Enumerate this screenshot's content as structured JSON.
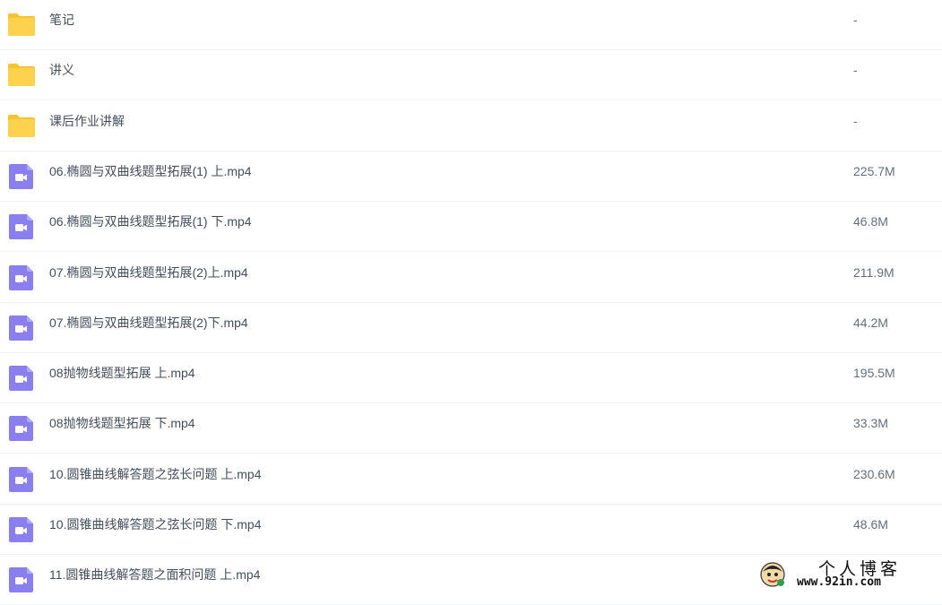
{
  "colors": {
    "folder": "#ffd24d",
    "folder_tab": "#f7c431",
    "video": "#8b7ff0",
    "row_divider": "#f1f2f4",
    "name_text": "#454d5a",
    "size_text": "#666e7a"
  },
  "files": [
    {
      "type": "folder",
      "icon": "folder-icon",
      "name": "笔记",
      "size": "-"
    },
    {
      "type": "folder",
      "icon": "folder-icon",
      "name": "讲义",
      "size": "-"
    },
    {
      "type": "folder",
      "icon": "folder-icon",
      "name": "课后作业讲解",
      "size": "-"
    },
    {
      "type": "video",
      "icon": "video-file-icon",
      "name": "06.椭圆与双曲线题型拓展(1) 上.mp4",
      "size": "225.7M"
    },
    {
      "type": "video",
      "icon": "video-file-icon",
      "name": "06.椭圆与双曲线题型拓展(1) 下.mp4",
      "size": "46.8M"
    },
    {
      "type": "video",
      "icon": "video-file-icon",
      "name": "07.椭圆与双曲线题型拓展(2)上.mp4",
      "size": "211.9M"
    },
    {
      "type": "video",
      "icon": "video-file-icon",
      "name": "07.椭圆与双曲线题型拓展(2)下.mp4",
      "size": "44.2M"
    },
    {
      "type": "video",
      "icon": "video-file-icon",
      "name": "08抛物线题型拓展 上.mp4",
      "size": "195.5M"
    },
    {
      "type": "video",
      "icon": "video-file-icon",
      "name": "08抛物线题型拓展 下.mp4",
      "size": "33.3M"
    },
    {
      "type": "video",
      "icon": "video-file-icon",
      "name": "10.圆锥曲线解答题之弦长问题 上.mp4",
      "size": "230.6M"
    },
    {
      "type": "video",
      "icon": "video-file-icon",
      "name": "10.圆锥曲线解答题之弦长问题 下.mp4",
      "size": "48.6M"
    },
    {
      "type": "video",
      "icon": "video-file-icon",
      "name": "11.圆锥曲线解答题之面积问题 上.mp4",
      "size": ""
    }
  ],
  "watermark": {
    "title": "个人博客",
    "url": "www.92in.com",
    "icon": "mascot-logo-icon"
  }
}
